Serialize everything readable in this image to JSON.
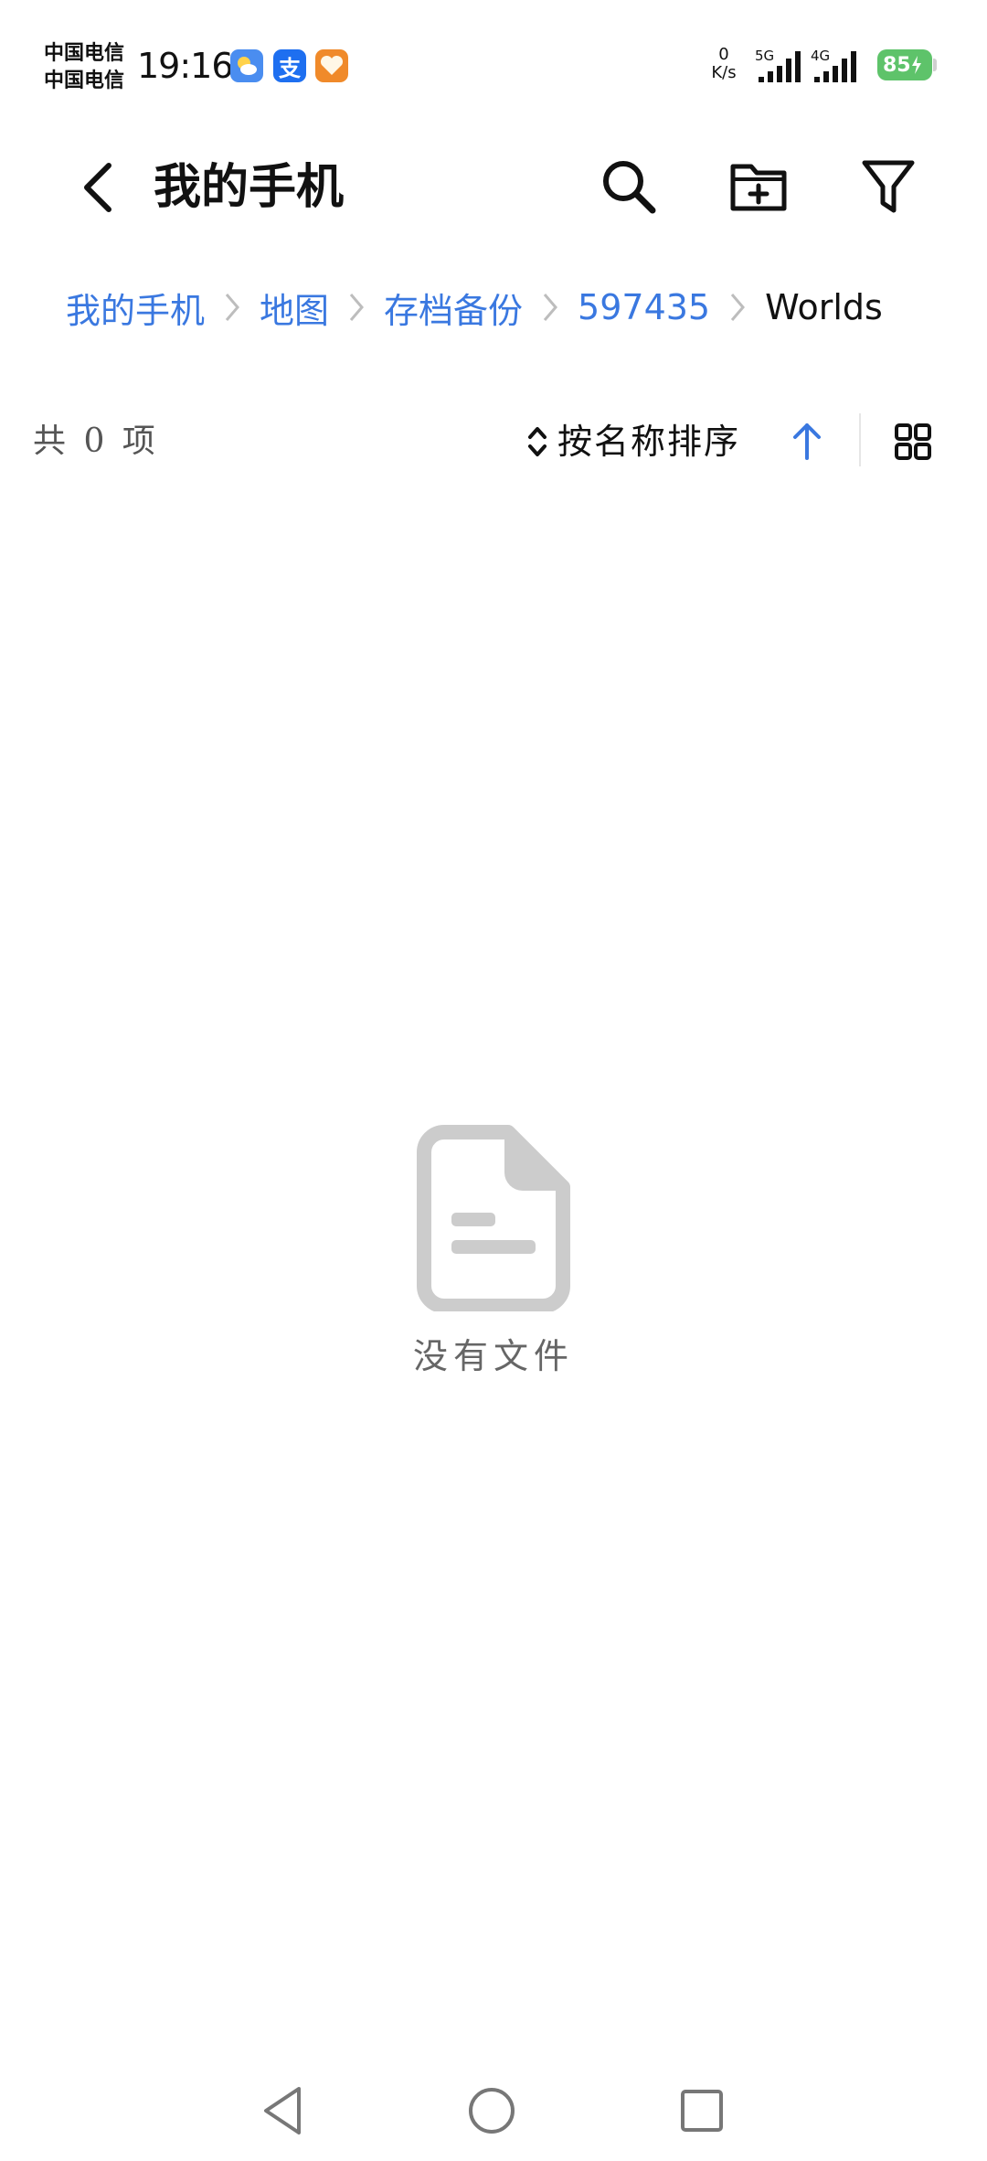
{
  "status_bar": {
    "carrier_1": "中国电信",
    "carrier_2": "中国电信",
    "time": "19:16",
    "net_speed_value": "0",
    "net_speed_unit": "K/s",
    "signal_1_label": "5G",
    "signal_2_label": "4G",
    "battery": "85",
    "battery_charging": true,
    "notification_icons": [
      "weather-app-icon",
      "alipay-app-icon",
      "health-app-icon"
    ],
    "alipay_glyph": "支"
  },
  "app_bar": {
    "title": "我的手机",
    "icons": [
      "back-arrow-icon",
      "search-icon",
      "new-folder-icon",
      "filter-icon"
    ]
  },
  "breadcrumb": {
    "items": [
      "我的手机",
      "地图",
      "存档备份",
      "597435",
      "Worlds"
    ]
  },
  "sort_bar": {
    "item_count": "共 0 项",
    "sort_label": "按名称排序",
    "sort_direction": "ascending",
    "view_mode": "grid"
  },
  "empty_state": {
    "message": "没有文件"
  },
  "nav_bar": {
    "buttons": [
      "back-triangle-icon",
      "home-circle-icon",
      "recent-square-icon"
    ]
  },
  "colors": {
    "accent": "#3a78e0",
    "text_primary": "#111111",
    "text_secondary": "#666666",
    "icon_gray": "#cccccc",
    "battery_green": "#5ec36a"
  }
}
